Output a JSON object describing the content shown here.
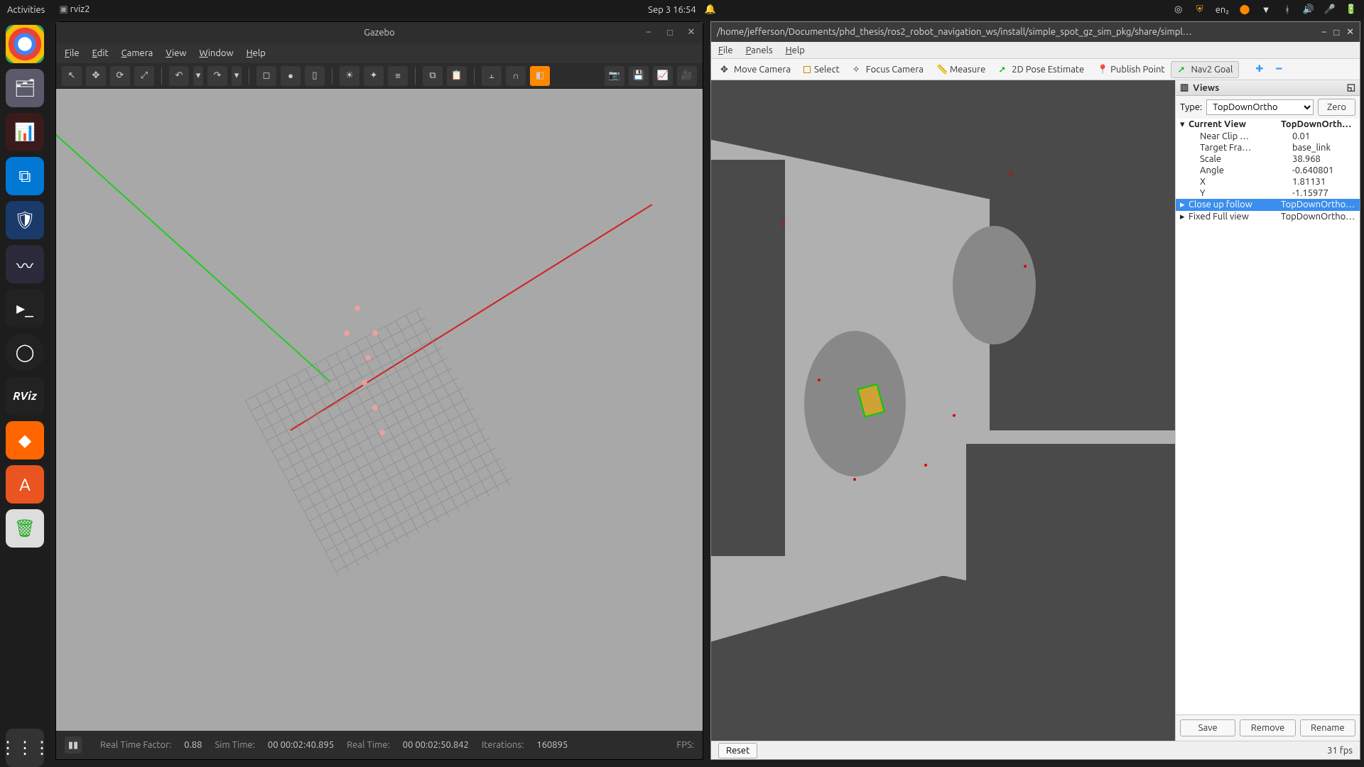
{
  "topbar": {
    "activities": "Activities",
    "app_indicator": "rviz2",
    "datetime": "Sep 3  16:54",
    "lang": "en₂"
  },
  "gazebo": {
    "title": "Gazebo",
    "menu": [
      "File",
      "Edit",
      "Camera",
      "View",
      "Window",
      "Help"
    ],
    "status": {
      "rtf_label": "Real Time Factor:",
      "rtf_value": "0.88",
      "simtime_label": "Sim Time:",
      "simtime_value": "00 00:02:40.895",
      "realtime_label": "Real Time:",
      "realtime_value": "00 00:02:50.842",
      "iter_label": "Iterations:",
      "iter_value": "160895",
      "fps_label": "FPS:"
    }
  },
  "rviz": {
    "title": "/home/jefferson/Documents/phd_thesis/ros2_robot_navigation_ws/install/simple_spot_gz_sim_pkg/share/simpl…",
    "menu": [
      "File",
      "Panels",
      "Help"
    ],
    "tools": {
      "move_camera": "Move Camera",
      "select": "Select",
      "focus_camera": "Focus Camera",
      "measure": "Measure",
      "pose_estimate": "2D Pose Estimate",
      "publish_point": "Publish Point",
      "nav2_goal": "Nav2 Goal"
    },
    "views_panel": {
      "header": "Views",
      "type_label": "Type:",
      "type_value": "TopDownOrtho",
      "zero": "Zero",
      "current_view": "Current View",
      "current_view_type": "TopDownOrtho …",
      "near_clip_label": "Near Clip …",
      "near_clip_value": "0.01",
      "target_frame_label": "Target Fra…",
      "target_frame_value": "base_link",
      "scale_label": "Scale",
      "scale_value": "38.968",
      "angle_label": "Angle",
      "angle_value": "-0.640801",
      "x_label": "X",
      "x_value": "1.81131",
      "y_label": "Y",
      "y_value": "-1.15977",
      "closeup_label": "Close up follow",
      "closeup_type": "TopDownOrtho …",
      "fixed_label": "Fixed Full view",
      "fixed_type": "TopDownOrtho …",
      "save": "Save",
      "remove": "Remove",
      "rename": "Rename"
    },
    "status": {
      "reset": "Reset",
      "fps": "31 fps"
    }
  }
}
